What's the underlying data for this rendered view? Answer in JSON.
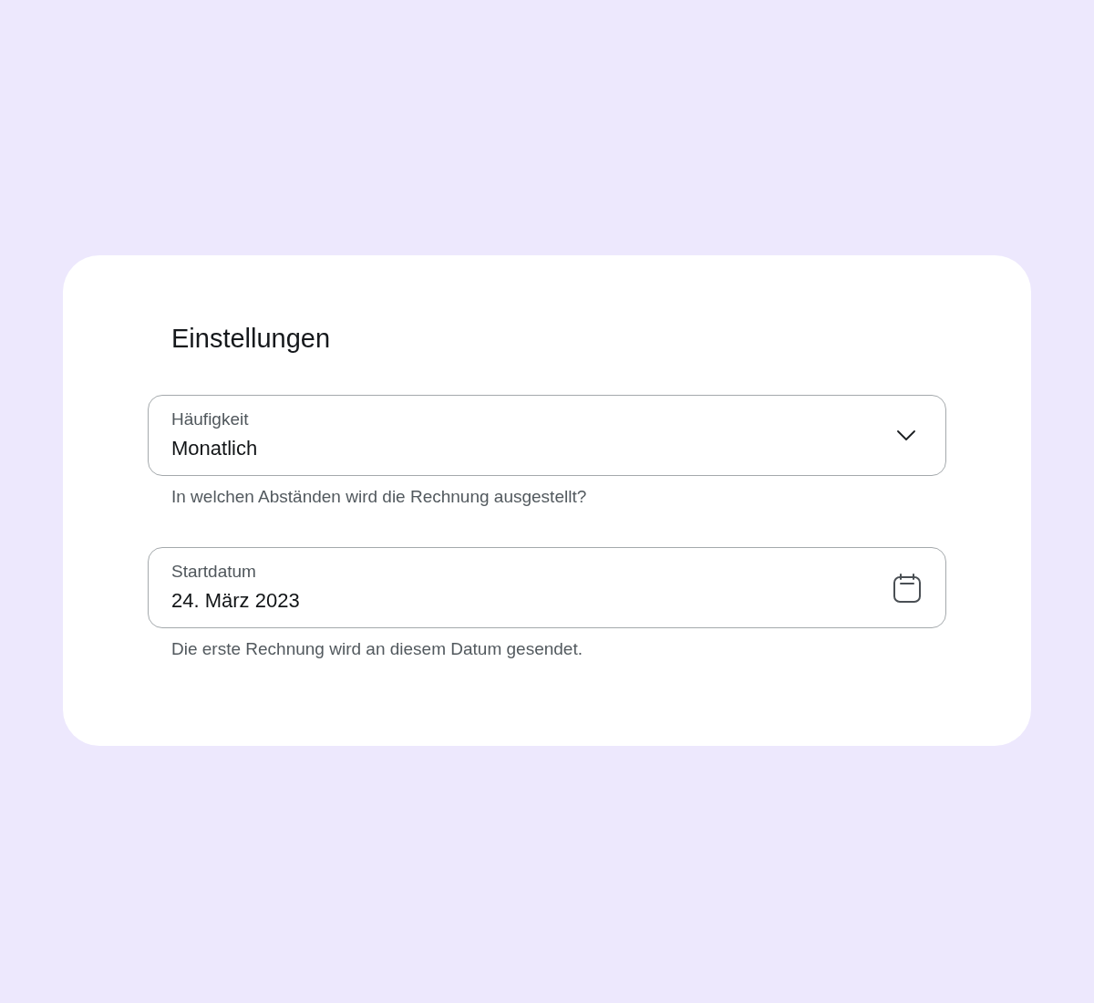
{
  "card": {
    "title": "Einstellungen",
    "fields": [
      {
        "kind": "select",
        "label": "Häufigkeit",
        "value": "Monatlich",
        "helper": "In welchen Abständen wird die Rechnung ausgestellt?"
      },
      {
        "kind": "date",
        "label": "Startdatum",
        "value": "24. März 2023",
        "helper": "Die erste Rechnung wird an diesem Datum gesendet."
      }
    ]
  }
}
